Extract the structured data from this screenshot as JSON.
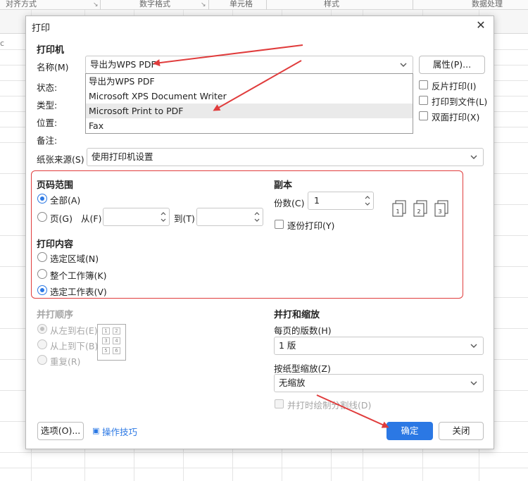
{
  "spreadsheet": {
    "ribbon_groups": [
      "对齐方式",
      "数字格式",
      "单元格",
      "样式",
      "数据处理"
    ],
    "left_mark": "c"
  },
  "dialog": {
    "title": "打印",
    "close_icon": "close-icon",
    "printer": {
      "heading": "打印机",
      "name_label": "名称(M)",
      "name_value": "导出为WPS PDF",
      "properties_button": "属性(P)...",
      "status_label": "状态:",
      "type_label": "类型:",
      "location_label": "位置:",
      "comment_label": "备注:",
      "options": [
        "导出为WPS PDF",
        "Microsoft XPS Document Writer",
        "Microsoft Print to PDF",
        "Fax"
      ],
      "highlighted_option": "Microsoft Print to PDF",
      "reverse_print": "反片打印(I)",
      "print_to_file": "打印到文件(L)",
      "duplex": "双面打印(X)"
    },
    "paper_source": {
      "label": "纸张来源(S)",
      "value": "使用打印机设置"
    },
    "page_range": {
      "heading": "页码范围",
      "all": "全部(A)",
      "pages": "页(G)",
      "from": "从(F)",
      "to": "到(T)",
      "from_value": "",
      "to_value": ""
    },
    "print_content": {
      "heading": "打印内容",
      "selection": "选定区域(N)",
      "workbook": "整个工作簿(K)",
      "sheet": "选定工作表(V)"
    },
    "copies": {
      "heading": "副本",
      "count_label": "份数(C)",
      "count_value": "1",
      "collate": "逐份打印(Y)",
      "collate_icons": [
        "1",
        "2",
        "3"
      ]
    },
    "collate_order": {
      "heading": "并打顺序",
      "left_to_right": "从左到右(E)",
      "top_to_bottom": "从上到下(B)",
      "repeat": "重复(R)",
      "mini_grid": [
        "1",
        "2",
        "3",
        "4",
        "5",
        "6"
      ]
    },
    "scaling": {
      "heading": "并打和缩放",
      "pages_per_sheet_label": "每页的版数(H)",
      "pages_per_sheet_value": "1 版",
      "scale_label": "按纸型缩放(Z)",
      "scale_value": "无缩放",
      "draw_lines": "并打时绘制分割线(D)"
    },
    "footer": {
      "options_button": "选项(O)...",
      "tips_link": "操作技巧",
      "ok_button": "确定",
      "close_button": "关闭"
    }
  },
  "colors": {
    "accent": "#2b78e4",
    "annotation_red": "#e03c3c"
  }
}
